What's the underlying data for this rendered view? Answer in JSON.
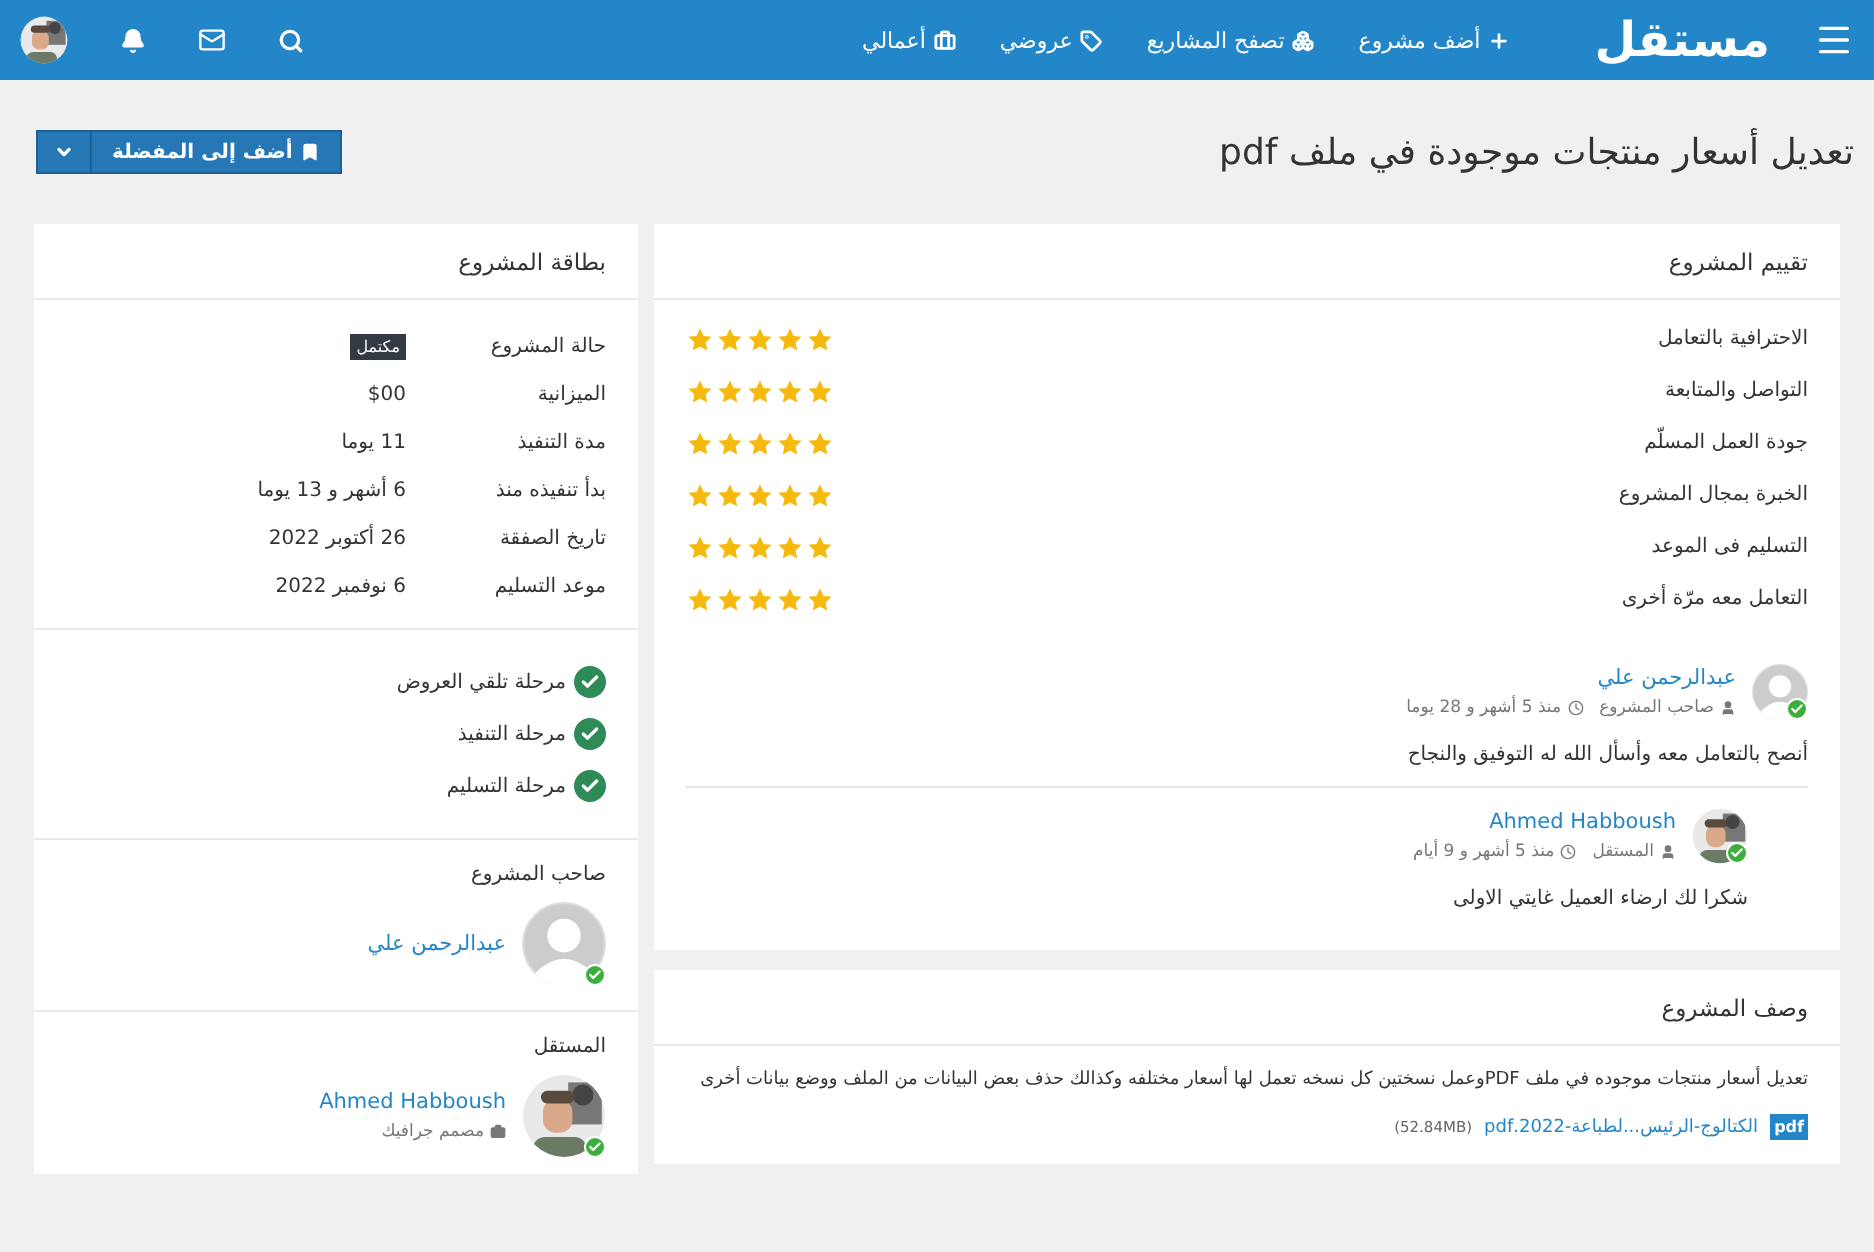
{
  "navbar": {
    "logo": "مستقل",
    "links": [
      {
        "label": "أضف مشروع"
      },
      {
        "label": "تصفح المشاريع"
      },
      {
        "label": "عروضي"
      },
      {
        "label": "أعمالي"
      }
    ]
  },
  "page": {
    "title": "تعديل أسعار منتجات موجودة في ملف pdf",
    "favorite_button": "أضف إلى المفضلة"
  },
  "ratings": {
    "title": "تقييم المشروع",
    "items": [
      {
        "label": "الاحترافية بالتعامل",
        "stars": 5
      },
      {
        "label": "التواصل والمتابعة",
        "stars": 5
      },
      {
        "label": "جودة العمل المسلّم",
        "stars": 5
      },
      {
        "label": "الخبرة بمجال المشروع",
        "stars": 5
      },
      {
        "label": "التسليم فى الموعد",
        "stars": 5
      },
      {
        "label": "التعامل معه مرّة أخرى",
        "stars": 5
      }
    ],
    "reviews": [
      {
        "name": "عبدالرحمن علي",
        "role": "صاحب المشروع",
        "time": "منذ 5 أشهر و 28 يوما",
        "text": "أنصح بالتعامل معه وأسأل الله له التوفيق والنجاح",
        "avatar": {
          "kind": "placeholder"
        },
        "online": true
      },
      {
        "name": "Ahmed Habboush",
        "role": "المستقل",
        "time": "منذ 5 أشهر و 9 أيام",
        "text": "شكرا لك ارضاء العميل غايتي الاولى",
        "online": true
      }
    ]
  },
  "description": {
    "title": "وصف المشروع",
    "text": "تعديل أسعار منتجات موجوده في ملف PDFوعمل نسختين كل نسخه تعمل لها أسعار مختلفه وكذالك حذف بعض البيانات من الملف ووضع بيانات أخرى",
    "attachment": {
      "type": "pdf",
      "name": "الكتالوج-الرئيس...لطباعة-2022.pdf",
      "size": "(52.84MB)"
    }
  },
  "project_card": {
    "title": "بطاقة المشروع",
    "rows": [
      {
        "label": "حالة المشروع",
        "value": "مكتمل",
        "kind": "badge"
      },
      {
        "label": "الميزانية",
        "value": "$00",
        "kind": "text"
      },
      {
        "label": "مدة التنفيذ",
        "value": "11 يوما",
        "kind": "text"
      },
      {
        "label": "بدأ تنفيذه منذ",
        "value": "6 أشهر و 13 يوما",
        "kind": "text"
      },
      {
        "label": "تاريخ الصفقة",
        "value": "26 أكتوبر 2022",
        "kind": "text"
      },
      {
        "label": "موعد التسليم",
        "value": "6 نوفمبر 2022",
        "kind": "text"
      }
    ],
    "stages": [
      {
        "label": "مرحلة تلقي العروض",
        "done": true
      },
      {
        "label": "مرحلة التنفيذ",
        "done": true
      },
      {
        "label": "مرحلة التسليم",
        "done": true
      }
    ],
    "owner": {
      "heading": "صاحب المشروع",
      "name": "عبدالرحمن علي",
      "avatar": {
        "kind": "placeholder"
      },
      "online": true
    },
    "freelancer": {
      "heading": "المستقل",
      "name": "Ahmed Habboush",
      "role": "مصمم جرافيك",
      "online": true
    }
  }
}
